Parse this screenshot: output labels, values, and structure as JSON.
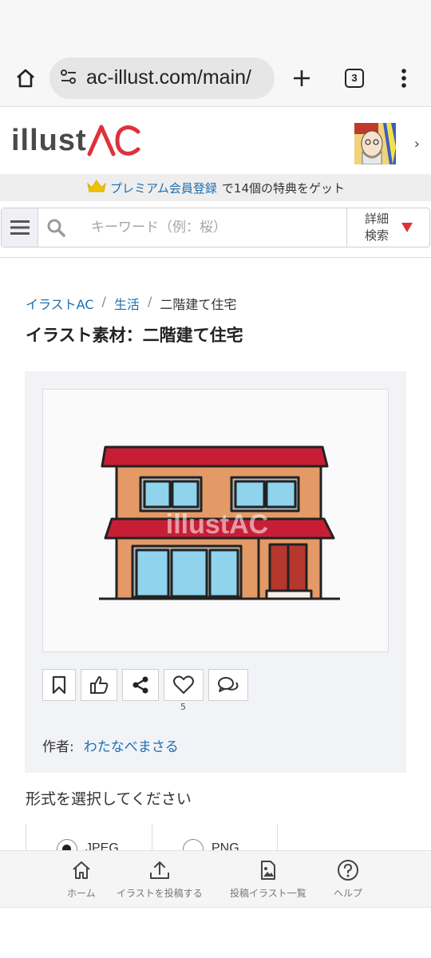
{
  "browser": {
    "url": "ac-illust.com/main/",
    "tab_count": "3"
  },
  "site": {
    "logo_text": "illust",
    "logo_ac": "AC"
  },
  "premium_banner": {
    "link": "プレミアム会員登録",
    "text": "で14個の特典をゲット"
  },
  "search": {
    "placeholder": "キーワード（例：桜）",
    "advanced_line1": "詳細",
    "advanced_line2": "検索"
  },
  "breadcrumb": {
    "items": [
      "イラストAC",
      "生活"
    ],
    "separator": "/",
    "current": "二階建て住宅"
  },
  "page_title": "イラスト素材：二階建て住宅",
  "image": {
    "watermark": "illustAC"
  },
  "actions": {
    "like_count": "5"
  },
  "author": {
    "label": "作者:",
    "name": "わたなべまさる"
  },
  "format": {
    "title": "形式を選択してください",
    "options": [
      "JPEG",
      "PNG"
    ],
    "selected": "JPEG"
  },
  "bottom_nav": {
    "items": [
      "ホーム",
      "イラストを投稿する",
      "投稿イラスト一覧",
      "ヘルプ"
    ]
  },
  "colors": {
    "accent_red": "#e0303c",
    "link_blue": "#1c6fb0"
  }
}
